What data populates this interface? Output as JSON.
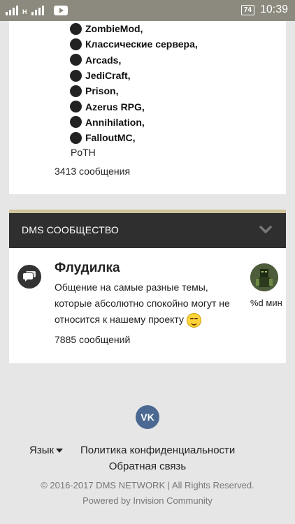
{
  "status_bar": {
    "network_indicator": "H",
    "battery": "74",
    "time": "10:39",
    "icons": [
      "signal-icon",
      "youtube-icon",
      "battery-icon"
    ]
  },
  "servers": {
    "items": [
      "ZombieMod,",
      "Классические сервера,",
      "Arcads,",
      "JediCraft,",
      "Prison,",
      "Azerus RPG,",
      "Annihilation,",
      "FalloutMC,"
    ],
    "extra": "PoTH",
    "message_count": "3413 сообщения"
  },
  "category": {
    "title": "DMS СООБЩЕСТВО",
    "accent_color": "#cfc39a",
    "header_color": "#2f2f2f"
  },
  "forum": {
    "title": "Флудилка",
    "description": "Общение на самые разные темы, которые абсолютно спокойно могут не относится к нашему проекту",
    "message_count": "7885 сообщений",
    "last_post_time": "%d мин"
  },
  "footer": {
    "vk_label": "VK",
    "language": "Язык",
    "privacy": "Политика конфиденциальности",
    "feedback": "Обратная связь",
    "copyright": "© 2016-2017 DMS NETWORK | All Rights Reserved.",
    "powered_by": "Powered by Invision Community"
  }
}
